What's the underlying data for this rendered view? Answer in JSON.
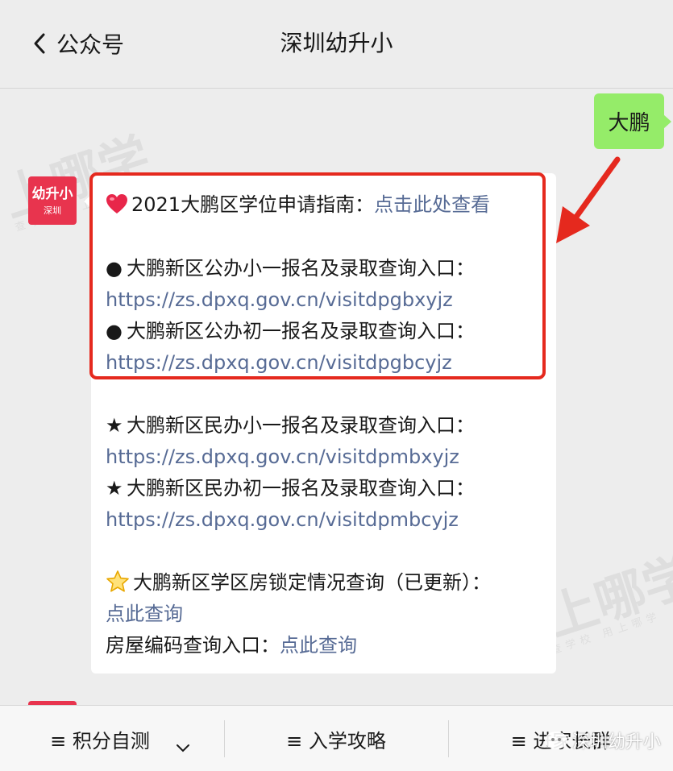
{
  "header": {
    "back_label": "公众号",
    "title": "深圳幼升小"
  },
  "user_message": "大鹏",
  "avatar": {
    "line1": "幼升小",
    "line2": "深圳"
  },
  "message": {
    "guide_title": "2021大鹏区学位申请指南：",
    "guide_link": "点击此处查看",
    "public_primary_label": "大鹏新区公办小一报名及录取查询入口：",
    "public_primary_url": "https://zs.dpxq.gov.cn/visitdpgbxyjz",
    "public_middle_label": "大鹏新区公办初一报名及录取查询入口：",
    "public_middle_url": "https://zs.dpxq.gov.cn/visitdpgbcyjz",
    "private_primary_label": "大鹏新区民办小一报名及录取查询入口：",
    "private_primary_url": "https://zs.dpxq.gov.cn/visitdpmbxyjz",
    "private_middle_label": "大鹏新区民办初一报名及录取查询入口：",
    "private_middle_url": "https://zs.dpxq.gov.cn/visitdpmbcyjz",
    "housing_lock_label": "大鹏新区学区房锁定情况查询（已更新）：",
    "housing_lock_link": "点此查询",
    "house_code_label": "房屋编码查询入口：",
    "house_code_link": "点此查询",
    "bullet_dot": "●",
    "bullet_star": "★"
  },
  "menu": {
    "item1": "≡ 积分自测",
    "item2": "≡ 入学攻略",
    "item3": "≡ 进家长群"
  },
  "watermark": {
    "big": "上哪学",
    "small": "查学校 用上哪学"
  },
  "brand_watermark": "深圳幼升小",
  "colors": {
    "link": "#576b95",
    "highlight": "#e5291e",
    "user_bubble": "#95ec69",
    "avatar": "#e8344e"
  }
}
